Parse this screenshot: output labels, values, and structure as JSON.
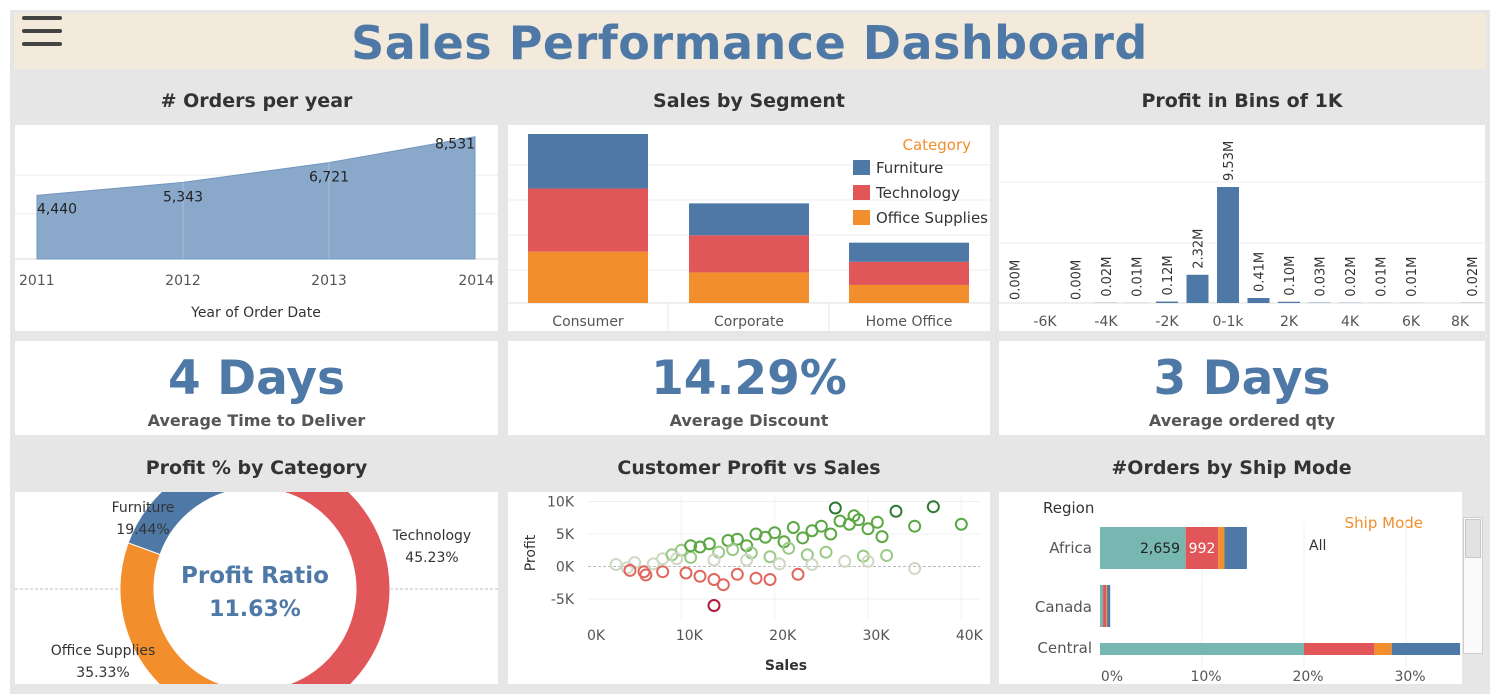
{
  "title": "Sales Performance Dashboard",
  "menu_icon": "hamburger-menu-icon",
  "colors": {
    "accent": "#4e79a7",
    "furniture": "#4e79a7",
    "technology": "#e15759",
    "office_supplies": "#f28e2b",
    "legend_title": "#f28e2b",
    "teal": "#76b7b2",
    "header_bg": "#f4eadb"
  },
  "panels": {
    "orders_per_year": {
      "title": "# Orders per year",
      "chart_data": {
        "type": "area",
        "x": [
          "2011",
          "2012",
          "2013",
          "2014"
        ],
        "values": [
          4440,
          5343,
          6721,
          8531
        ],
        "labels": [
          "4,440",
          "5,343",
          "6,721",
          "8,531"
        ],
        "xlabel": "Year of Order Date",
        "ylabel": "",
        "ylim": [
          0,
          9000
        ],
        "grid": true
      }
    },
    "sales_by_segment": {
      "title": "Sales by Segment",
      "chart_data": {
        "type": "bar",
        "stacked": true,
        "categories": [
          "Consumer",
          "Corporate",
          "Home Office"
        ],
        "series": [
          {
            "name": "Office Supplies",
            "color": "#f28e2b",
            "values": [
              1.93,
              1.15,
              0.68
            ]
          },
          {
            "name": "Technology",
            "color": "#e15759",
            "values": [
              2.38,
              1.4,
              0.87
            ]
          },
          {
            "name": "Furniture",
            "color": "#4e79a7",
            "values": [
              2.05,
              1.2,
              0.72
            ]
          }
        ],
        "legend_title": "Category",
        "legend": [
          "Furniture",
          "Technology",
          "Office Supplies"
        ],
        "legend_position": "top-right",
        "grid": true
      }
    },
    "profit_bins": {
      "title": "Profit in Bins of 1K",
      "chart_data": {
        "type": "bar",
        "x_ticks": [
          "-6K",
          "-4K",
          "-2K",
          "0-1k",
          "2K",
          "4K",
          "6K",
          "8K"
        ],
        "bins": [
          -7,
          -5,
          -4,
          -3,
          -2,
          -1,
          0,
          1,
          2,
          3,
          4,
          5,
          6,
          8
        ],
        "values": [
          0.0,
          0.0,
          0.02,
          0.01,
          0.12,
          2.32,
          9.53,
          0.41,
          0.1,
          0.03,
          0.02,
          0.01,
          0.01,
          0.02
        ],
        "labels": [
          "0.00M",
          "0.00M",
          "0.02M",
          "0.01M",
          "0.12M",
          "2.32M",
          "9.53M",
          "0.41M",
          "0.10M",
          "0.03M",
          "0.02M",
          "0.01M",
          "0.01M",
          "0.02M"
        ],
        "grid": true
      }
    },
    "kpi_deliver": {
      "value": "4 Days",
      "label": "Average Time to Deliver"
    },
    "kpi_discount": {
      "value": "14.29%",
      "label": "Average Discount"
    },
    "kpi_qty": {
      "value": "3 Days",
      "label": "Average ordered qty"
    },
    "profit_by_category": {
      "title": "Profit % by Category",
      "center_title": "Profit Ratio",
      "center_value": "11.63%",
      "chart_data": {
        "type": "pie",
        "donut": true,
        "categories": [
          "Technology",
          "Office Supplies",
          "Furniture"
        ],
        "values": [
          45.23,
          35.33,
          19.44
        ],
        "labels": [
          "45.23%",
          "35.33%",
          "19.44%"
        ],
        "colors": [
          "#e15759",
          "#f28e2b",
          "#4e79a7"
        ]
      }
    },
    "customer_profit_sales": {
      "title": "Customer Profit vs Sales",
      "chart_data": {
        "type": "scatter",
        "xlabel": "Sales",
        "ylabel": "Profit",
        "x_ticks": [
          "0K",
          "10K",
          "20K",
          "30K",
          "40K"
        ],
        "y_ticks": [
          "10K",
          "5K",
          "0K",
          "-5K"
        ],
        "xlim": [
          0,
          42000
        ],
        "ylim": [
          -7000,
          11000
        ],
        "points": [
          [
            3000,
            300
          ],
          [
            4200,
            -200
          ],
          [
            5000,
            600
          ],
          [
            6000,
            -800
          ],
          [
            7000,
            400
          ],
          [
            8000,
            1200
          ],
          [
            9000,
            1800
          ],
          [
            10000,
            2500
          ],
          [
            11000,
            1400
          ],
          [
            12000,
            3000
          ],
          [
            13000,
            3500
          ],
          [
            14000,
            2200
          ],
          [
            15000,
            4000
          ],
          [
            16000,
            4200
          ],
          [
            17000,
            3200
          ],
          [
            18000,
            5000
          ],
          [
            19000,
            4500
          ],
          [
            20000,
            5200
          ],
          [
            21000,
            3800
          ],
          [
            22000,
            6000
          ],
          [
            23000,
            4400
          ],
          [
            24000,
            5500
          ],
          [
            25000,
            6200
          ],
          [
            26000,
            5000
          ],
          [
            27000,
            7000
          ],
          [
            28000,
            6500
          ],
          [
            29000,
            7200
          ],
          [
            30000,
            5800
          ],
          [
            31000,
            6800
          ],
          [
            33000,
            8500
          ],
          [
            35000,
            6200
          ],
          [
            37000,
            9200
          ],
          [
            40000,
            6500
          ],
          [
            26500,
            9000
          ],
          [
            28500,
            7800
          ],
          [
            11000,
            3200
          ],
          [
            13500,
            1000
          ],
          [
            15500,
            2600
          ],
          [
            17500,
            2100
          ],
          [
            19500,
            1500
          ],
          [
            21500,
            2800
          ],
          [
            23500,
            1800
          ],
          [
            25500,
            2200
          ],
          [
            27500,
            800
          ],
          [
            29500,
            1600
          ],
          [
            32000,
            1700
          ],
          [
            35000,
            -300
          ],
          [
            17000,
            1000
          ],
          [
            20500,
            400
          ],
          [
            8000,
            -800
          ],
          [
            10500,
            -1000
          ],
          [
            12000,
            -1500
          ],
          [
            13500,
            -2000
          ],
          [
            14500,
            -2800
          ],
          [
            16000,
            -1200
          ],
          [
            18000,
            -1800
          ],
          [
            19500,
            -2000
          ],
          [
            22500,
            -1200
          ],
          [
            4500,
            -600
          ],
          [
            6200,
            -1300
          ],
          [
            13500,
            -6000
          ],
          [
            9500,
            1200
          ],
          [
            24000,
            300
          ],
          [
            30000,
            800
          ],
          [
            31500,
            4600
          ]
        ]
      }
    },
    "orders_by_ship_mode": {
      "title": "#Orders by Ship Mode",
      "region_header": "Region",
      "legend_title": "Ship Mode",
      "legend_all": "All",
      "chart_data": {
        "type": "bar",
        "stacked": true,
        "horizontal": true,
        "categories": [
          "Africa",
          "Canada",
          "Central"
        ],
        "x_ticks": [
          "0%",
          "10%",
          "20%",
          "30%"
        ],
        "xlim": [
          0,
          35
        ],
        "series": [
          {
            "color": "#76b7b2",
            "values": [
              8.4,
              0.3,
              20.0
            ]
          },
          {
            "color": "#e15759",
            "values": [
              3.2,
              0.3,
              6.9
            ]
          },
          {
            "color": "#f28e2b",
            "values": [
              0.6,
              0.1,
              1.7
            ]
          },
          {
            "color": "#4e79a7",
            "values": [
              2.2,
              0.3,
              6.7
            ]
          }
        ],
        "segment_labels": [
          [
            "2,659",
            "992",
            "",
            ""
          ],
          [
            "",
            "",
            "",
            ""
          ],
          [
            "",
            "",
            "",
            ""
          ]
        ]
      }
    }
  }
}
